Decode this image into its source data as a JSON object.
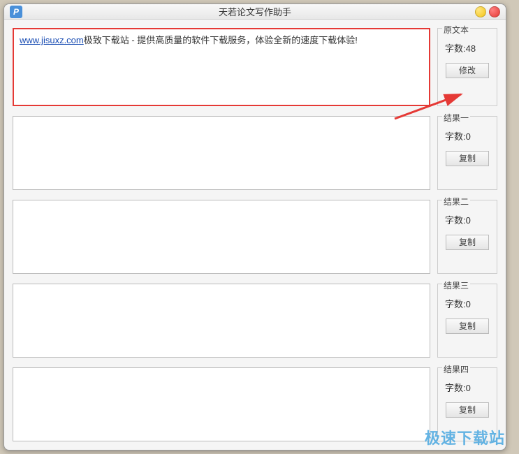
{
  "window": {
    "title": "天若论文写作助手",
    "icon_letter": "P"
  },
  "source": {
    "link_text": "www.jisuxz.com",
    "body_text": "极致下载站 - 提供高质量的软件下载服务，体验全新的速度下载体验!",
    "panel_title": "原文本",
    "count_prefix": "字数:",
    "count_value": "48",
    "button_label": "修改"
  },
  "results": [
    {
      "panel_title": "结果一",
      "count_prefix": "字数:",
      "count_value": "0",
      "button_label": "复制"
    },
    {
      "panel_title": "结果二",
      "count_prefix": "字数:",
      "count_value": "0",
      "button_label": "复制"
    },
    {
      "panel_title": "结果三",
      "count_prefix": "字数:",
      "count_value": "0",
      "button_label": "复制"
    },
    {
      "panel_title": "结果四",
      "count_prefix": "字数:",
      "count_value": "0",
      "button_label": "复制"
    }
  ],
  "watermark": "极速下载站"
}
